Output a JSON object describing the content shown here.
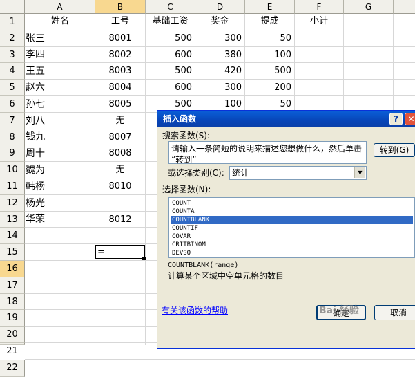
{
  "columns": [
    "A",
    "B",
    "C",
    "D",
    "E",
    "F",
    "G"
  ],
  "selected_column": "B",
  "rows": [
    "1",
    "2",
    "3",
    "4",
    "5",
    "6",
    "7",
    "8",
    "9",
    "10",
    "11",
    "12",
    "13",
    "14",
    "15",
    "16",
    "17",
    "18",
    "19",
    "20",
    "21",
    "22"
  ],
  "selected_row": "16",
  "header_row": [
    "姓名",
    "工号",
    "基础工资",
    "奖金",
    "提成",
    "小计"
  ],
  "data_rows": [
    {
      "name": "张三",
      "id": "8001",
      "base": "500",
      "bonus": "300",
      "comm": "50"
    },
    {
      "name": "李四",
      "id": "8002",
      "base": "600",
      "bonus": "380",
      "comm": "100"
    },
    {
      "name": "王五",
      "id": "8003",
      "base": "500",
      "bonus": "420",
      "comm": "500"
    },
    {
      "name": "赵六",
      "id": "8004",
      "base": "600",
      "bonus": "300",
      "comm": "200"
    },
    {
      "name": "孙七",
      "id": "8005",
      "base": "500",
      "bonus": "100",
      "comm": "50"
    },
    {
      "name": "刘八",
      "id": "无"
    },
    {
      "name": "钱九",
      "id": "8007"
    },
    {
      "name": "周十",
      "id": "8008"
    },
    {
      "name": "魏为",
      "id": "无"
    },
    {
      "name": "韩杨",
      "id": "8010"
    },
    {
      "name": "杨光",
      "id": ""
    },
    {
      "name": "华荣",
      "id": "8012"
    }
  ],
  "active_cell": {
    "ref": "B16",
    "content": "="
  },
  "dialog": {
    "title": "插入函数",
    "help_glyph": "?",
    "close_glyph": "✕",
    "search_label": "搜索函数(S):",
    "search_text_line1": "请输入一条简短的说明来描述您想做什么，然后单击",
    "search_text_line2": "“转到”",
    "goto_button": "转到(G)",
    "category_label": "或选择类别(C):",
    "category_value": "统计",
    "function_label": "选择函数(N):",
    "functions": [
      "COUNT",
      "COUNTA",
      "COUNTBLANK",
      "COUNTIF",
      "COVAR",
      "CRITBINOM",
      "DEVSQ"
    ],
    "selected_function": "COUNTBLANK",
    "signature": "COUNTBLANK(range)",
    "description": "计算某个区域中空单元格的数目",
    "help_link": "有关该函数的帮助",
    "ok_button": "确定",
    "cancel_button": "取消"
  },
  "watermark": "Bai 经验"
}
